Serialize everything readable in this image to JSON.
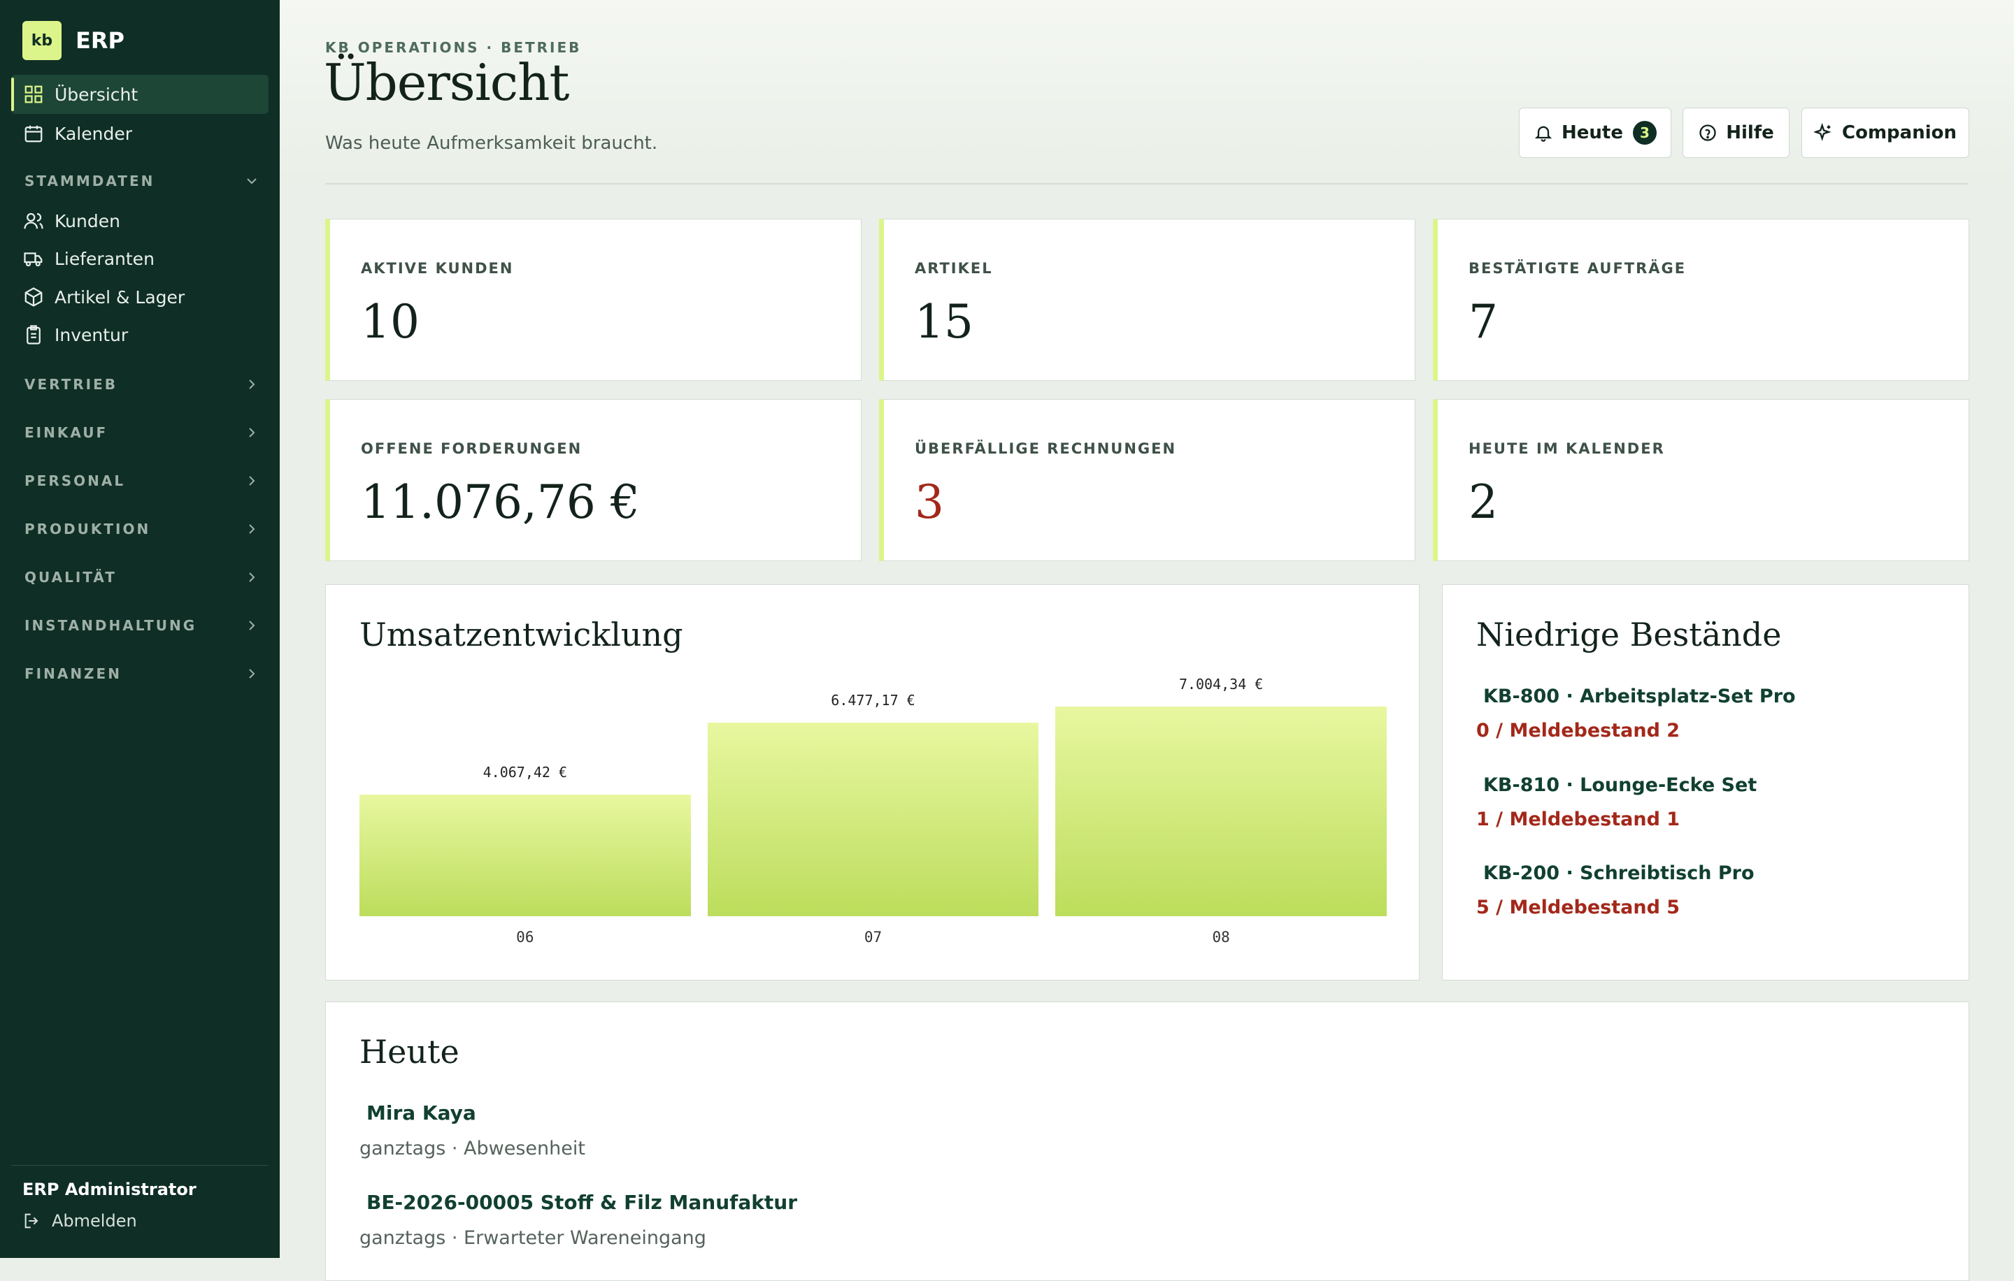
{
  "brand": {
    "logo": "kb",
    "name": "ERP"
  },
  "sidebar": {
    "items": [
      {
        "label": "Übersicht",
        "icon": "dashboard-icon"
      },
      {
        "label": "Kalender",
        "icon": "calendar-icon"
      }
    ],
    "stammdaten": {
      "label": "STAMMDATEN",
      "items": [
        {
          "label": "Kunden",
          "icon": "users-icon"
        },
        {
          "label": "Lieferanten",
          "icon": "truck-icon"
        },
        {
          "label": "Artikel & Lager",
          "icon": "box-icon"
        },
        {
          "label": "Inventur",
          "icon": "clipboard-icon"
        }
      ]
    },
    "groups": [
      "VERTRIEB",
      "EINKAUF",
      "PERSONAL",
      "PRODUKTION",
      "QUALITÄT",
      "INSTANDHALTUNG",
      "FINANZEN"
    ],
    "user": "ERP Administrator",
    "logout": "Abmelden"
  },
  "header": {
    "eyebrow": "KB OPERATIONS · BETRIEB",
    "title": "Übersicht",
    "subtitle": "Was heute Aufmerksamkeit braucht.",
    "buttons": {
      "today": "Heute",
      "today_count": "3",
      "help": "Hilfe",
      "companion": "Companion"
    }
  },
  "stats": [
    {
      "label": "AKTIVE KUNDEN",
      "value": "10"
    },
    {
      "label": "ARTIKEL",
      "value": "15"
    },
    {
      "label": "BESTÄTIGTE AUFTRÄGE",
      "value": "7"
    },
    {
      "label": "OFFENE FORDERUNGEN",
      "value": "11.076,76 €"
    },
    {
      "label": "ÜBERFÄLLIGE RECHNUNGEN",
      "value": "3"
    },
    {
      "label": "HEUTE IM KALENDER",
      "value": "2"
    }
  ],
  "revenue": {
    "title": "Umsatzentwicklung"
  },
  "chart_data": {
    "type": "bar",
    "title": "Umsatzentwicklung",
    "categories": [
      "06",
      "07",
      "08"
    ],
    "values": [
      4067.42,
      6477.17,
      7004.34
    ],
    "value_labels": [
      "4.067,42 €",
      "6.477,17 €",
      "7.004,34 €"
    ],
    "ylim": [
      0,
      7004.34
    ],
    "grid": false,
    "color": "#c9e66e"
  },
  "low_stock": {
    "title": "Niedrige Bestände",
    "items": [
      {
        "name": "KB-800 · Arbeitsplatz-Set Pro",
        "qty": "0 / Meldebestand 2"
      },
      {
        "name": "KB-810 · Lounge-Ecke Set",
        "qty": "1 / Meldebestand 1"
      },
      {
        "name": "KB-200 · Schreibtisch Pro",
        "qty": "5 / Meldebestand 5"
      }
    ]
  },
  "today": {
    "title": "Heute",
    "events": [
      {
        "title": "Mira Kaya",
        "sub": "ganztags · Abwesenheit"
      },
      {
        "title": "BE-2026-00005 Stoff & Filz Manufaktur",
        "sub": "ganztags · Erwarteter Wareneingang"
      }
    ]
  },
  "colors": {
    "sidebar": "#0f2e25",
    "accent": "#dcf58a",
    "danger": "#a3281a",
    "link": "#11402f"
  }
}
